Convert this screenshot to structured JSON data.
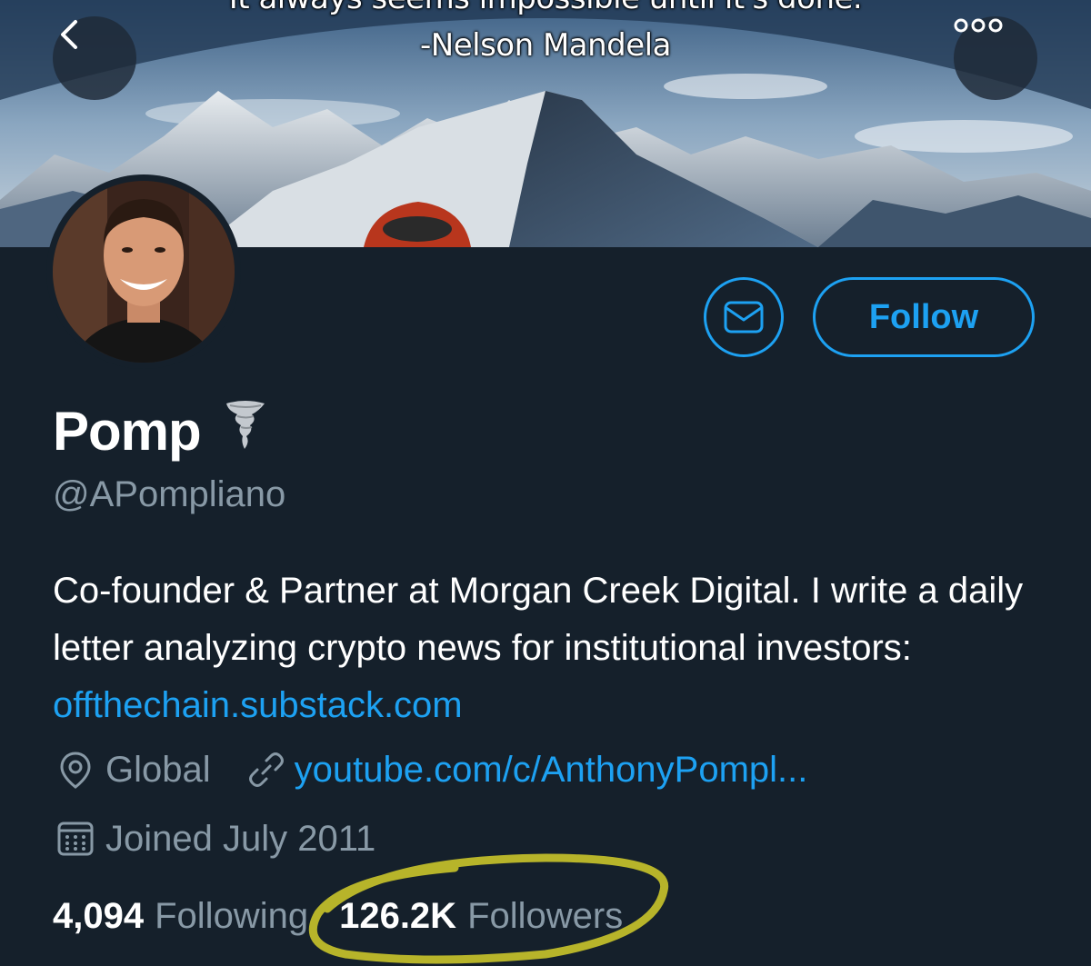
{
  "banner": {
    "quote_line_1": "It always seems impossible until it's done.",
    "quote_line_2": "-Nelson Mandela"
  },
  "nav": {
    "back_icon": "chevron-left-icon",
    "more_icon": "more-horizontal-icon"
  },
  "actions": {
    "message_icon": "envelope-icon",
    "follow_label": "Follow"
  },
  "profile": {
    "name": "Pomp",
    "name_emoji": "tornado-emoji",
    "handle": "@APompliano",
    "bio_text": "Co-founder & Partner at Morgan Creek Digital. I write a daily letter analyzing crypto news for institutional investors: ",
    "bio_link": "offthechain.substack.com",
    "location": "Global",
    "website": "youtube.com/c/AnthonyPompl...",
    "joined": "Joined July 2011"
  },
  "stats": {
    "following_count": "4,094",
    "following_label": "Following",
    "followers_count": "126.2K",
    "followers_label": "Followers"
  },
  "colors": {
    "background": "#15202b",
    "accent": "#1da1f2",
    "secondary_text": "#8899a6",
    "highlight": "#d4cf2a"
  }
}
